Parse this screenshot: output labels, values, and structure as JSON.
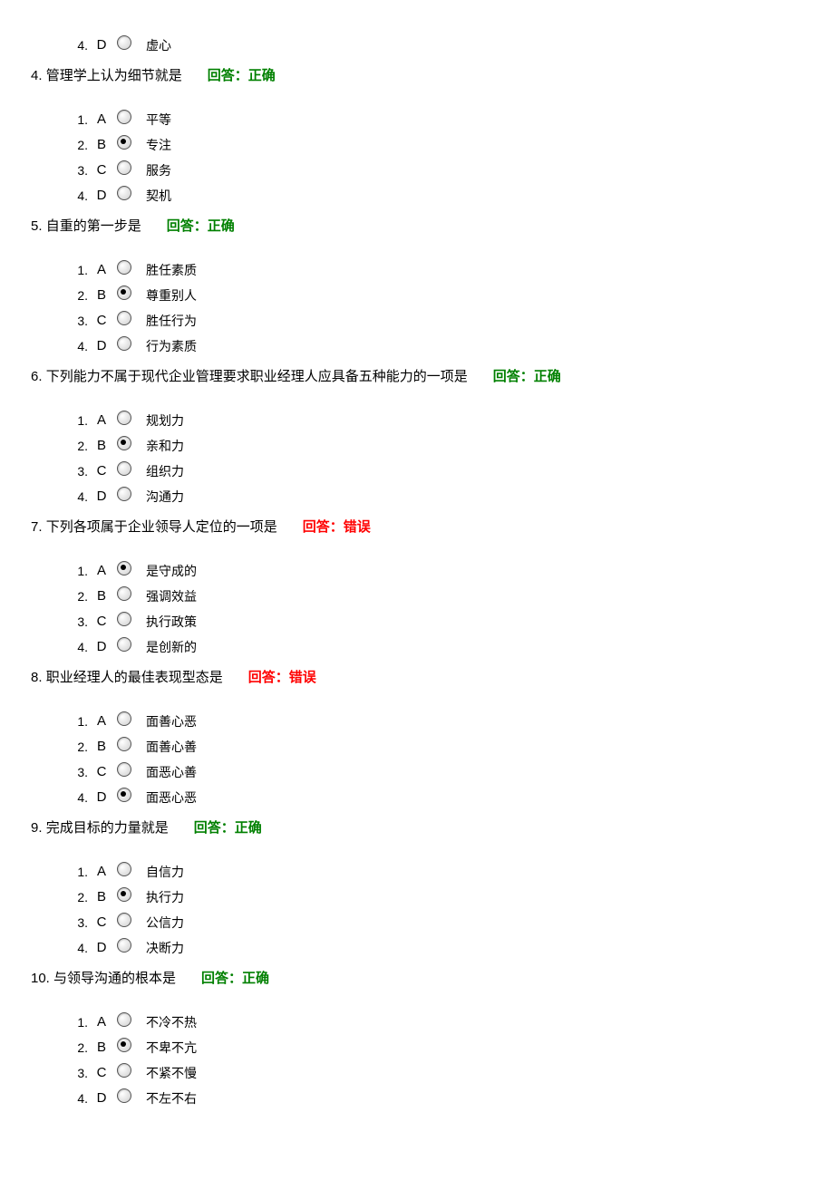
{
  "orphan_option": {
    "num": "4.",
    "letter": "D",
    "selected": false,
    "text": "虚心"
  },
  "feedback_correct": "回答：正确",
  "feedback_wrong": "回答：错误",
  "questions": [
    {
      "number": "4.",
      "text": "管理学上认为细节就是",
      "status": "correct",
      "options": [
        {
          "num": "1.",
          "letter": "A",
          "selected": false,
          "text": "平等"
        },
        {
          "num": "2.",
          "letter": "B",
          "selected": true,
          "text": "专注"
        },
        {
          "num": "3.",
          "letter": "C",
          "selected": false,
          "text": "服务"
        },
        {
          "num": "4.",
          "letter": "D",
          "selected": false,
          "text": "契机"
        }
      ]
    },
    {
      "number": "5.",
      "text": "自重的第一步是",
      "status": "correct",
      "options": [
        {
          "num": "1.",
          "letter": "A",
          "selected": false,
          "text": "胜任素质"
        },
        {
          "num": "2.",
          "letter": "B",
          "selected": true,
          "text": "尊重别人"
        },
        {
          "num": "3.",
          "letter": "C",
          "selected": false,
          "text": "胜任行为"
        },
        {
          "num": "4.",
          "letter": "D",
          "selected": false,
          "text": "行为素质"
        }
      ]
    },
    {
      "number": "6.",
      "text": "下列能力不属于现代企业管理要求职业经理人应具备五种能力的一项是",
      "status": "correct",
      "options": [
        {
          "num": "1.",
          "letter": "A",
          "selected": false,
          "text": "规划力"
        },
        {
          "num": "2.",
          "letter": "B",
          "selected": true,
          "text": "亲和力"
        },
        {
          "num": "3.",
          "letter": "C",
          "selected": false,
          "text": "组织力"
        },
        {
          "num": "4.",
          "letter": "D",
          "selected": false,
          "text": "沟通力"
        }
      ]
    },
    {
      "number": "7.",
      "text": "下列各项属于企业领导人定位的一项是",
      "status": "wrong",
      "options": [
        {
          "num": "1.",
          "letter": "A",
          "selected": true,
          "text": "是守成的"
        },
        {
          "num": "2.",
          "letter": "B",
          "selected": false,
          "text": "强调效益"
        },
        {
          "num": "3.",
          "letter": "C",
          "selected": false,
          "text": "执行政策"
        },
        {
          "num": "4.",
          "letter": "D",
          "selected": false,
          "text": "是创新的"
        }
      ]
    },
    {
      "number": "8.",
      "text": "职业经理人的最佳表现型态是",
      "status": "wrong",
      "options": [
        {
          "num": "1.",
          "letter": "A",
          "selected": false,
          "text": "面善心恶"
        },
        {
          "num": "2.",
          "letter": "B",
          "selected": false,
          "text": "面善心善"
        },
        {
          "num": "3.",
          "letter": "C",
          "selected": false,
          "text": "面恶心善"
        },
        {
          "num": "4.",
          "letter": "D",
          "selected": true,
          "text": "面恶心恶"
        }
      ]
    },
    {
      "number": "9.",
      "text": "完成目标的力量就是",
      "status": "correct",
      "options": [
        {
          "num": "1.",
          "letter": "A",
          "selected": false,
          "text": "自信力"
        },
        {
          "num": "2.",
          "letter": "B",
          "selected": true,
          "text": "执行力"
        },
        {
          "num": "3.",
          "letter": "C",
          "selected": false,
          "text": "公信力"
        },
        {
          "num": "4.",
          "letter": "D",
          "selected": false,
          "text": "决断力"
        }
      ]
    },
    {
      "number": "10.",
      "text": "与领导沟通的根本是",
      "status": "correct",
      "options": [
        {
          "num": "1.",
          "letter": "A",
          "selected": false,
          "text": "不冷不热"
        },
        {
          "num": "2.",
          "letter": "B",
          "selected": true,
          "text": "不卑不亢"
        },
        {
          "num": "3.",
          "letter": "C",
          "selected": false,
          "text": "不紧不慢"
        },
        {
          "num": "4.",
          "letter": "D",
          "selected": false,
          "text": "不左不右"
        }
      ]
    }
  ]
}
